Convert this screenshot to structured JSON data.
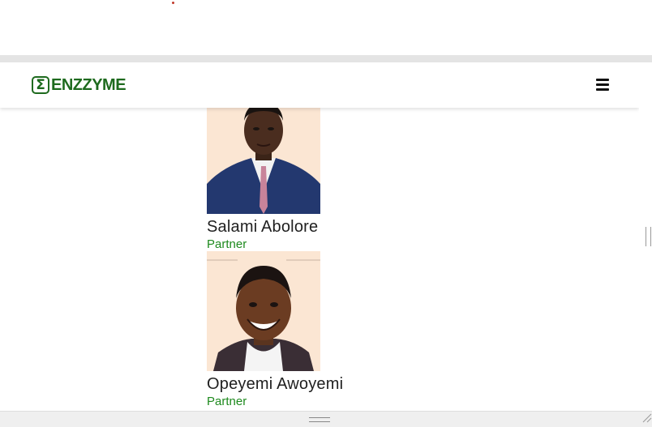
{
  "brand": {
    "logo_symbol": "Σ",
    "name": "ENZZYME",
    "color": "#1e6a1e"
  },
  "nav": {
    "menu_icon": "hamburger-menu-icon"
  },
  "team": [
    {
      "name": "Salami Abolore",
      "role": "Partner"
    },
    {
      "name": "Opeyemi Awoyemi",
      "role": "Partner"
    }
  ],
  "colors": {
    "role": "#1e8a1e",
    "photo_bg": "#fbe6d3"
  }
}
